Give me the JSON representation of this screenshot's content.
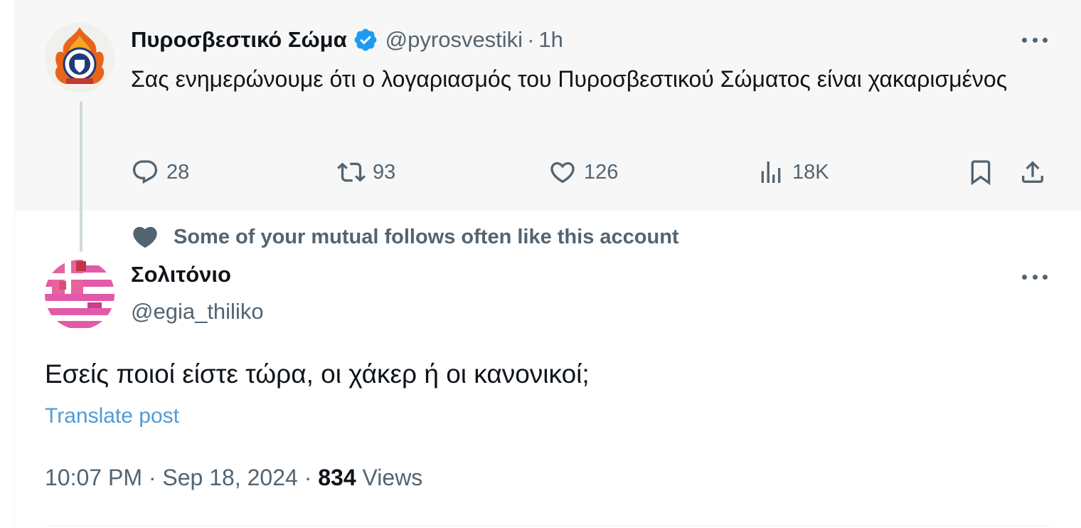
{
  "parent_post": {
    "display_name": "Πυροσβεστικό Σώμα",
    "verified": true,
    "handle": "@pyrosvestiki",
    "separator": "·",
    "time": "1h",
    "text": "Σας ενημερώνουμε ότι ο λογαριασμός του Πυροσβεστικού Σώματος είναι χακαρισμένος",
    "avatar_icon": "fire-service-emblem-icon",
    "metrics": {
      "replies": "28",
      "reposts": "93",
      "likes": "126",
      "views": "18K"
    }
  },
  "social_context": {
    "text": "Some of your mutual follows often like this account",
    "icon": "heart-icon"
  },
  "reply_post": {
    "display_name": "Σολιτόνιο",
    "handle": "@egia_thiliko",
    "avatar_icon": "pink-greek-flag-icon",
    "text": "Εσείς ποιοί είστε τώρα, οι χάκερ ή οι κανονικοί;",
    "translate_label": "Translate post",
    "timestamp": "10:07 PM · Sep 18, 2024",
    "dot": "·",
    "views_count": "834",
    "views_label": "Views"
  },
  "colors": {
    "text_primary": "#0f1419",
    "text_secondary": "#536471",
    "link": "#4e9bd9",
    "verified": "#1d9bf0",
    "parent_bg": "#f7f7f7"
  }
}
